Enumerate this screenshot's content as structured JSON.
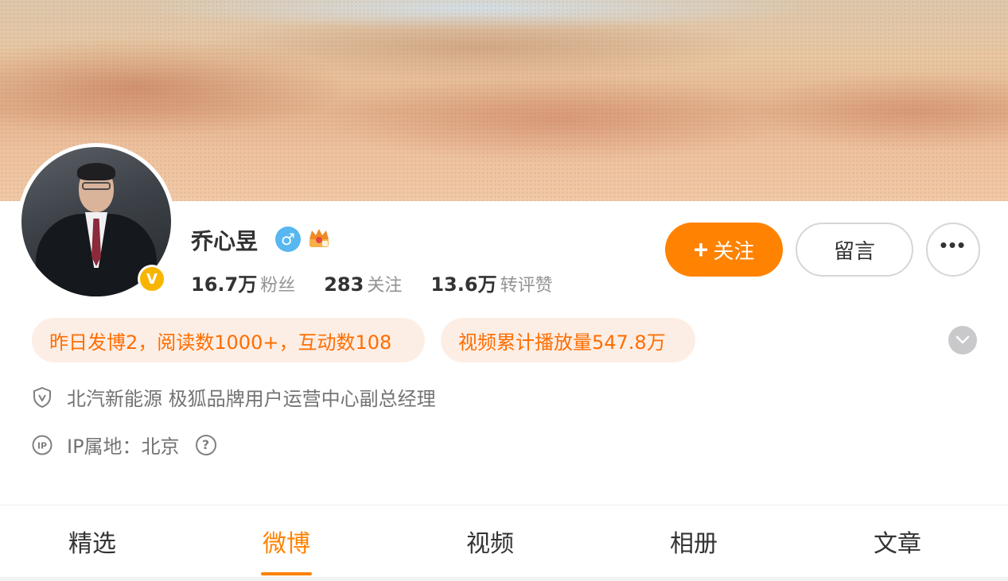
{
  "profile": {
    "name": "乔心昱",
    "verified_badge": "V",
    "gender_symbol": "♂",
    "stats": [
      {
        "value": "16.7万",
        "label": "粉丝"
      },
      {
        "value": "283",
        "label": "关注"
      },
      {
        "value": "13.6万",
        "label": "转评赞"
      }
    ]
  },
  "actions": {
    "follow_plus": "+",
    "follow_label": "关注",
    "message_label": "留言",
    "more_label": "•••"
  },
  "highlights": [
    "昨日发博2，阅读数1000+，互动数108",
    "视频累计播放量547.8万"
  ],
  "info": {
    "title": "北汽新能源 极狐品牌用户运营中心副总经理",
    "ip": "IP属地：北京",
    "help_symbol": "?"
  },
  "tabs": [
    {
      "label": "精选",
      "active": false
    },
    {
      "label": "微博",
      "active": true
    },
    {
      "label": "视频",
      "active": false
    },
    {
      "label": "相册",
      "active": false
    },
    {
      "label": "文章",
      "active": false
    }
  ],
  "colors": {
    "accent": "#ff8200",
    "highlight_text": "#ff6d00",
    "highlight_bg": "#fdeee5",
    "verified": "#f7b500",
    "gender": "#58b7f0"
  },
  "icons": {
    "gender": "male-icon",
    "crown": "crown-icon",
    "verified": "verified-v-icon",
    "work": "shield-v-icon",
    "ip": "ip-icon",
    "help": "help-icon",
    "more": "more-icon",
    "expand": "chevron-down-icon"
  }
}
